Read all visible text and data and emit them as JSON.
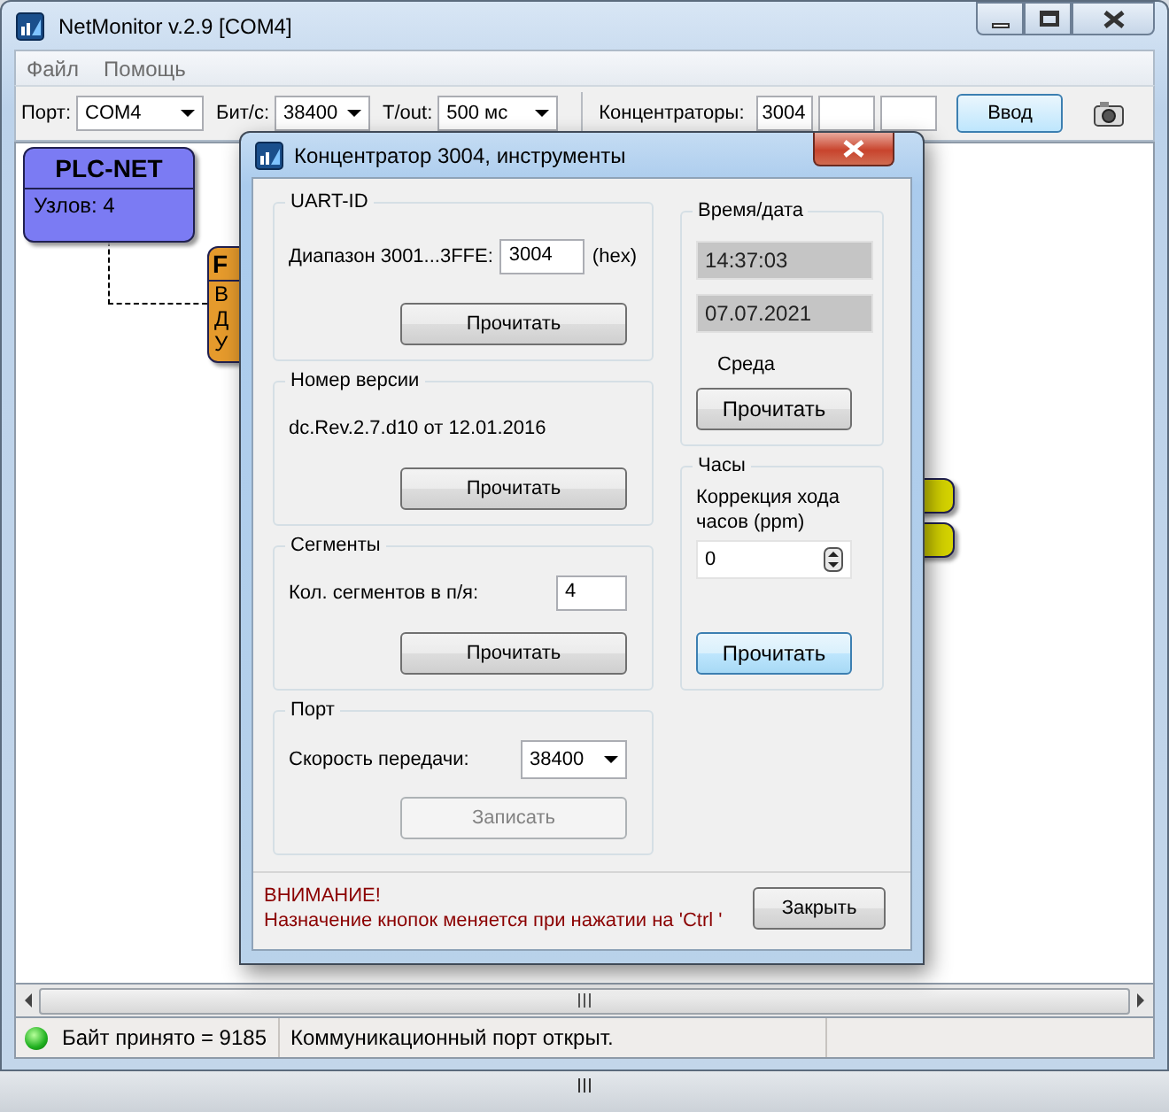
{
  "window": {
    "title": "NetMonitor v.2.9 [COM4]"
  },
  "menu": [
    {
      "label": "Файл"
    },
    {
      "label": "Помощь"
    }
  ],
  "toolbar": {
    "port": {
      "label": "Порт:",
      "value": "COM4"
    },
    "baud": {
      "label": "Бит/с:",
      "value": "38400"
    },
    "timeout": {
      "label": "T/out:",
      "value": "500 мс"
    },
    "concentrators": {
      "label": "Концентраторы:",
      "values": [
        "3004"
      ]
    },
    "enter_button": "Ввод"
  },
  "diagram": {
    "nodes": [
      {
        "title": "PLC-NET",
        "lines": [
          "Узлов: 4"
        ],
        "color": "#7b7bf3"
      },
      {
        "title": "F",
        "lines": [
          "В",
          "Д",
          "У"
        ],
        "color": "#e59a2c"
      },
      {
        "color": "#d6d400"
      },
      {
        "color": "#d6d400"
      }
    ]
  },
  "dialog": {
    "title": "Концентратор 3004, инструменты",
    "uart": {
      "title": "UART-ID",
      "label": "Диапазон 3001...3FFE:",
      "value": "3004",
      "unit": "(hex)",
      "button": {
        "label": "Прочитать",
        "disabled": false,
        "highlighted": false
      }
    },
    "version": {
      "title": "Номер версии",
      "text": "dc.Rev.2.7.d10 от 12.01.2016",
      "button": {
        "label": "Прочитать",
        "disabled": false,
        "highlighted": false
      }
    },
    "segments": {
      "title": "Сегменты",
      "label": "Кол. сегментов в п/я:",
      "value": "4",
      "button": {
        "label": "Прочитать",
        "disabled": false,
        "highlighted": false
      }
    },
    "port": {
      "title": "Порт",
      "label": "Скорость передачи:",
      "value": "38400",
      "button": {
        "label": "Записать",
        "disabled": true,
        "highlighted": false
      }
    },
    "datetime": {
      "title": "Время/дата",
      "time": "14:37:03",
      "date": "07.07.2021",
      "weekday": "Среда",
      "button": {
        "label": "Прочитать",
        "disabled": false,
        "highlighted": false
      }
    },
    "clock": {
      "title": "Часы",
      "label": "Коррекция хода часов (ppm)",
      "value": "0",
      "button": {
        "label": "Прочитать",
        "disabled": false,
        "highlighted": true
      }
    },
    "warning": {
      "title": "ВНИМАНИЕ!",
      "text": "Назначение кнопок меняется при нажатии на 'Ctrl '"
    },
    "close_button": "Закрыть"
  },
  "status_bar": {
    "connected": true,
    "received": "Байт принято = 9185",
    "message": "Коммуникационный порт открыт."
  }
}
